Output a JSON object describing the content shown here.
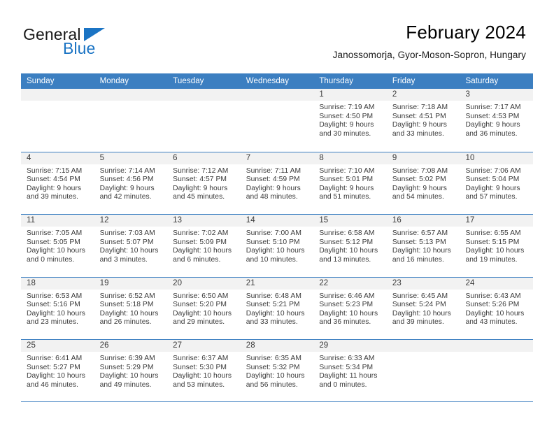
{
  "brand": {
    "line1": "General",
    "line2": "Blue",
    "flag_icon": "triangle-flag-icon",
    "accent_color": "#1b74c4"
  },
  "header": {
    "title": "February 2024",
    "subtitle": "Janossomorja, Gyor-Moson-Sopron, Hungary"
  },
  "calendar": {
    "header_bg": "#3c7fc1",
    "row_divider": "#3c7fc1",
    "numband_bg": "#f2f2f2",
    "weekdays": [
      "Sunday",
      "Monday",
      "Tuesday",
      "Wednesday",
      "Thursday",
      "Friday",
      "Saturday"
    ],
    "weeks": [
      [
        {
          "day": "",
          "lines": []
        },
        {
          "day": "",
          "lines": []
        },
        {
          "day": "",
          "lines": []
        },
        {
          "day": "",
          "lines": []
        },
        {
          "day": "1",
          "lines": [
            "Sunrise: 7:19 AM",
            "Sunset: 4:50 PM",
            "Daylight: 9 hours",
            "and 30 minutes."
          ]
        },
        {
          "day": "2",
          "lines": [
            "Sunrise: 7:18 AM",
            "Sunset: 4:51 PM",
            "Daylight: 9 hours",
            "and 33 minutes."
          ]
        },
        {
          "day": "3",
          "lines": [
            "Sunrise: 7:17 AM",
            "Sunset: 4:53 PM",
            "Daylight: 9 hours",
            "and 36 minutes."
          ]
        }
      ],
      [
        {
          "day": "4",
          "lines": [
            "Sunrise: 7:15 AM",
            "Sunset: 4:54 PM",
            "Daylight: 9 hours",
            "and 39 minutes."
          ]
        },
        {
          "day": "5",
          "lines": [
            "Sunrise: 7:14 AM",
            "Sunset: 4:56 PM",
            "Daylight: 9 hours",
            "and 42 minutes."
          ]
        },
        {
          "day": "6",
          "lines": [
            "Sunrise: 7:12 AM",
            "Sunset: 4:57 PM",
            "Daylight: 9 hours",
            "and 45 minutes."
          ]
        },
        {
          "day": "7",
          "lines": [
            "Sunrise: 7:11 AM",
            "Sunset: 4:59 PM",
            "Daylight: 9 hours",
            "and 48 minutes."
          ]
        },
        {
          "day": "8",
          "lines": [
            "Sunrise: 7:10 AM",
            "Sunset: 5:01 PM",
            "Daylight: 9 hours",
            "and 51 minutes."
          ]
        },
        {
          "day": "9",
          "lines": [
            "Sunrise: 7:08 AM",
            "Sunset: 5:02 PM",
            "Daylight: 9 hours",
            "and 54 minutes."
          ]
        },
        {
          "day": "10",
          "lines": [
            "Sunrise: 7:06 AM",
            "Sunset: 5:04 PM",
            "Daylight: 9 hours",
            "and 57 minutes."
          ]
        }
      ],
      [
        {
          "day": "11",
          "lines": [
            "Sunrise: 7:05 AM",
            "Sunset: 5:05 PM",
            "Daylight: 10 hours",
            "and 0 minutes."
          ]
        },
        {
          "day": "12",
          "lines": [
            "Sunrise: 7:03 AM",
            "Sunset: 5:07 PM",
            "Daylight: 10 hours",
            "and 3 minutes."
          ]
        },
        {
          "day": "13",
          "lines": [
            "Sunrise: 7:02 AM",
            "Sunset: 5:09 PM",
            "Daylight: 10 hours",
            "and 6 minutes."
          ]
        },
        {
          "day": "14",
          "lines": [
            "Sunrise: 7:00 AM",
            "Sunset: 5:10 PM",
            "Daylight: 10 hours",
            "and 10 minutes."
          ]
        },
        {
          "day": "15",
          "lines": [
            "Sunrise: 6:58 AM",
            "Sunset: 5:12 PM",
            "Daylight: 10 hours",
            "and 13 minutes."
          ]
        },
        {
          "day": "16",
          "lines": [
            "Sunrise: 6:57 AM",
            "Sunset: 5:13 PM",
            "Daylight: 10 hours",
            "and 16 minutes."
          ]
        },
        {
          "day": "17",
          "lines": [
            "Sunrise: 6:55 AM",
            "Sunset: 5:15 PM",
            "Daylight: 10 hours",
            "and 19 minutes."
          ]
        }
      ],
      [
        {
          "day": "18",
          "lines": [
            "Sunrise: 6:53 AM",
            "Sunset: 5:16 PM",
            "Daylight: 10 hours",
            "and 23 minutes."
          ]
        },
        {
          "day": "19",
          "lines": [
            "Sunrise: 6:52 AM",
            "Sunset: 5:18 PM",
            "Daylight: 10 hours",
            "and 26 minutes."
          ]
        },
        {
          "day": "20",
          "lines": [
            "Sunrise: 6:50 AM",
            "Sunset: 5:20 PM",
            "Daylight: 10 hours",
            "and 29 minutes."
          ]
        },
        {
          "day": "21",
          "lines": [
            "Sunrise: 6:48 AM",
            "Sunset: 5:21 PM",
            "Daylight: 10 hours",
            "and 33 minutes."
          ]
        },
        {
          "day": "22",
          "lines": [
            "Sunrise: 6:46 AM",
            "Sunset: 5:23 PM",
            "Daylight: 10 hours",
            "and 36 minutes."
          ]
        },
        {
          "day": "23",
          "lines": [
            "Sunrise: 6:45 AM",
            "Sunset: 5:24 PM",
            "Daylight: 10 hours",
            "and 39 minutes."
          ]
        },
        {
          "day": "24",
          "lines": [
            "Sunrise: 6:43 AM",
            "Sunset: 5:26 PM",
            "Daylight: 10 hours",
            "and 43 minutes."
          ]
        }
      ],
      [
        {
          "day": "25",
          "lines": [
            "Sunrise: 6:41 AM",
            "Sunset: 5:27 PM",
            "Daylight: 10 hours",
            "and 46 minutes."
          ]
        },
        {
          "day": "26",
          "lines": [
            "Sunrise: 6:39 AM",
            "Sunset: 5:29 PM",
            "Daylight: 10 hours",
            "and 49 minutes."
          ]
        },
        {
          "day": "27",
          "lines": [
            "Sunrise: 6:37 AM",
            "Sunset: 5:30 PM",
            "Daylight: 10 hours",
            "and 53 minutes."
          ]
        },
        {
          "day": "28",
          "lines": [
            "Sunrise: 6:35 AM",
            "Sunset: 5:32 PM",
            "Daylight: 10 hours",
            "and 56 minutes."
          ]
        },
        {
          "day": "29",
          "lines": [
            "Sunrise: 6:33 AM",
            "Sunset: 5:34 PM",
            "Daylight: 11 hours",
            "and 0 minutes."
          ]
        },
        {
          "day": "",
          "lines": []
        },
        {
          "day": "",
          "lines": []
        }
      ]
    ]
  }
}
